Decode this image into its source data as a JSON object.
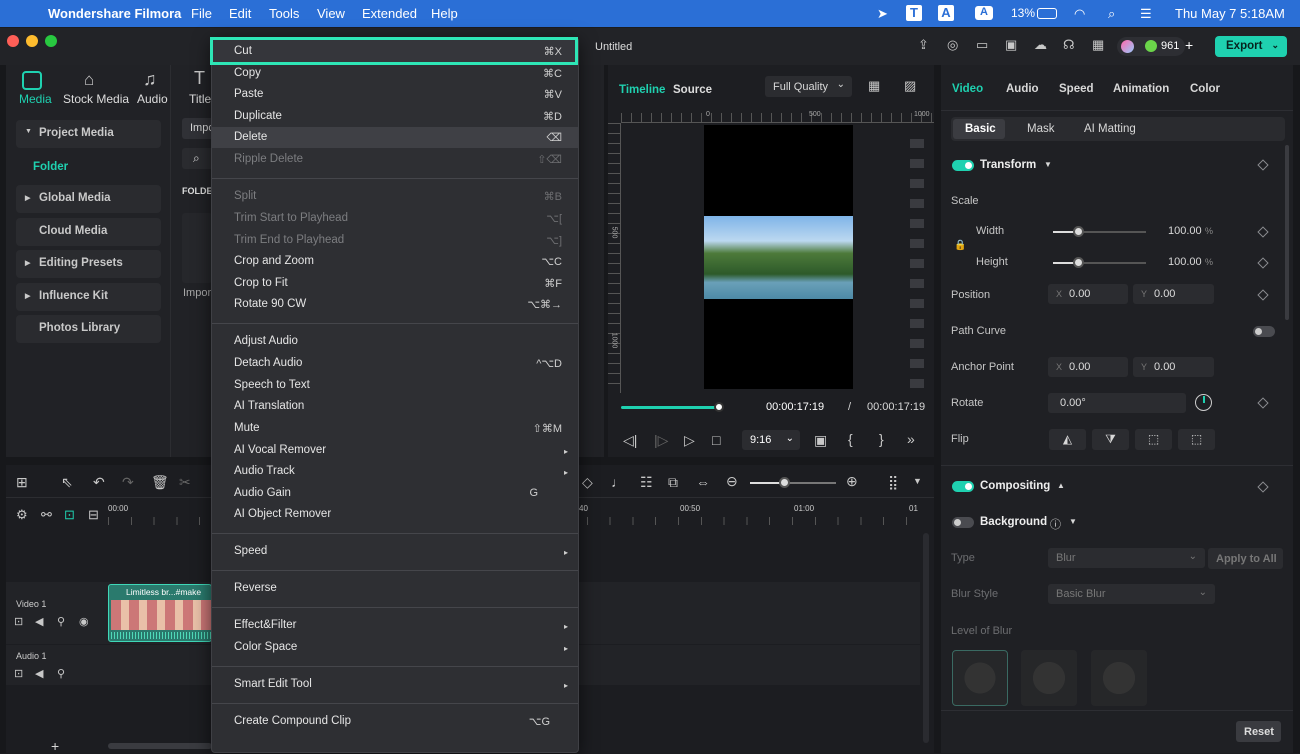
{
  "menubar": {
    "app": "Wondershare Filmora",
    "items": [
      "File",
      "Edit",
      "Tools",
      "View",
      "Extended",
      "Help"
    ],
    "battery": "13%",
    "datetime": "Thu May 7  5:18AM"
  },
  "window": {
    "title": "Untitled",
    "credits": "961",
    "export": "Export"
  },
  "media_tabs": [
    "Media",
    "Stock Media",
    "Audio",
    "Titles"
  ],
  "sidebar": [
    "Project Media",
    "Folder",
    "Global Media",
    "Cloud Media",
    "Editing Presets",
    "Influence Kit",
    "Photos Library"
  ],
  "media": {
    "import_btn": "Impo",
    "folder_label": "FOLDE",
    "import_tile": "Impor"
  },
  "preview": {
    "tab_timeline": "Timeline",
    "tab_source": "Source",
    "quality": "Full Quality",
    "ruler": [
      "0",
      "500",
      "1000"
    ],
    "vruler": [
      "500",
      "1000"
    ],
    "time_current": "00:00:17:19",
    "time_sep": "/",
    "time_total": "00:00:17:19",
    "ratio": "9:16"
  },
  "props": {
    "tabs": [
      "Video",
      "Audio",
      "Speed",
      "Animation",
      "Color"
    ],
    "subtabs": [
      "Basic",
      "Mask",
      "AI Matting"
    ],
    "transform": "Transform",
    "scale": "Scale",
    "width": "Width",
    "width_val": "100.00",
    "height": "Height",
    "height_val": "100.00",
    "pct": "%",
    "position": "Position",
    "pos_x": "0.00",
    "pos_y": "0.00",
    "x": "X",
    "y": "Y",
    "path_curve": "Path Curve",
    "anchor": "Anchor Point",
    "anc_x": "0.00",
    "anc_y": "0.00",
    "rotate": "Rotate",
    "rotate_val": "0.00°",
    "flip": "Flip",
    "compositing": "Compositing",
    "background": "Background",
    "type": "Type",
    "type_val": "Blur",
    "apply_all": "Apply to All",
    "blur_style": "Blur Style",
    "blur_style_val": "Basic Blur",
    "level_blur": "Level of Blur",
    "reset": "Reset"
  },
  "timeline": {
    "ruler": [
      "00:00",
      "40",
      "00:50",
      "01:00",
      "01"
    ],
    "video_track": "Video 1",
    "audio_track": "Audio 1",
    "clip_title": "Limitless br...#make"
  },
  "context_menu": [
    {
      "label": "Cut",
      "shortcut": "⌘X",
      "state": "highlighted"
    },
    {
      "label": "Copy",
      "shortcut": "⌘C"
    },
    {
      "label": "Paste",
      "shortcut": "⌘V"
    },
    {
      "label": "Duplicate",
      "shortcut": "⌘D"
    },
    {
      "label": "Delete",
      "shortcut": "⌫",
      "state": "hover"
    },
    {
      "label": "Ripple Delete",
      "shortcut": "⇧⌫",
      "state": "disabled"
    },
    {
      "label": "Split",
      "shortcut": "⌘B",
      "state": "disabled"
    },
    {
      "label": "Trim Start to Playhead",
      "shortcut": "⌥[",
      "state": "disabled"
    },
    {
      "label": "Trim End to Playhead",
      "shortcut": "⌥]",
      "state": "disabled"
    },
    {
      "label": "Crop and Zoom",
      "shortcut": "⌥C"
    },
    {
      "label": "Crop to Fit",
      "shortcut": "⌘F"
    },
    {
      "label": "Rotate 90 CW",
      "shortcut": "⌥⌘→"
    },
    {
      "label": "Adjust Audio",
      "shortcut": ""
    },
    {
      "label": "Detach Audio",
      "shortcut": "^⌥D"
    },
    {
      "label": "Speech to Text",
      "shortcut": ""
    },
    {
      "label": "AI Translation",
      "shortcut": ""
    },
    {
      "label": "Mute",
      "shortcut": "⇧⌘M"
    },
    {
      "label": "AI Vocal Remover",
      "shortcut": "▸"
    },
    {
      "label": "Audio Track",
      "shortcut": "▸"
    },
    {
      "label": "Audio Gain",
      "shortcut": "G"
    },
    {
      "label": "AI Object Remover",
      "shortcut": ""
    },
    {
      "label": "Speed",
      "shortcut": "▸"
    },
    {
      "label": "Reverse",
      "shortcut": ""
    },
    {
      "label": "Effect&Filter",
      "shortcut": "▸"
    },
    {
      "label": "Color Space",
      "shortcut": "▸"
    },
    {
      "label": "Smart Edit Tool",
      "shortcut": "▸"
    },
    {
      "label": "Create Compound Clip",
      "shortcut": "⌥G"
    }
  ],
  "colors": {
    "accent": "#1fd1b0",
    "menubar": "#2b6fd6",
    "highlight": "#2ee6b6"
  }
}
